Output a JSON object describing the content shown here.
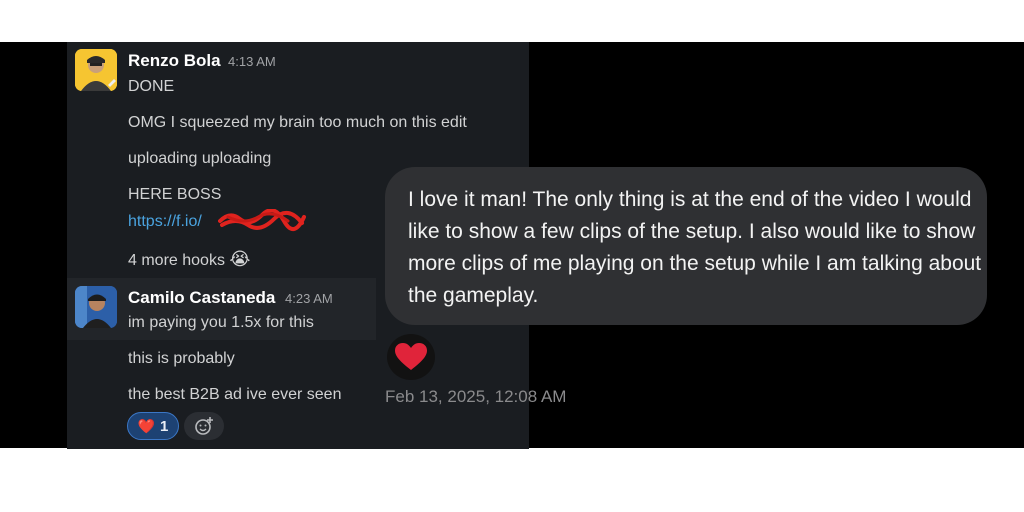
{
  "slack": {
    "messages": [
      {
        "author": "Renzo Bola",
        "time": "4:13 AM",
        "lines": [
          "DONE",
          "OMG I squeezed my brain too much on this edit",
          "uploading uploading",
          "HERE BOSS"
        ],
        "link": "https://f.io/",
        "hooks_text": "4 more hooks",
        "hooks_emoji": "😭"
      },
      {
        "author": "Camilo Castaneda",
        "time": "4:23 AM",
        "lines": [
          "im paying you 1.5x for this",
          "this is probably",
          "the best B2B ad ive ever seen"
        ],
        "reaction": {
          "emoji": "❤️",
          "count": "1"
        }
      }
    ]
  },
  "imessage": {
    "bubble_text": "I love it man! The only thing is at the end of the video I would like to show a few clips of the setup. I also would like to show more clips of me playing on the setup while I am talking about the gameplay.",
    "tapback": "heart-icon",
    "timestamp": "Feb 13, 2025, 12:08 AM"
  },
  "colors": {
    "slack_bg": "#1a1d21",
    "link": "#4aa3df",
    "bubble_bg": "#2f3033",
    "heart": "#e0243a"
  }
}
